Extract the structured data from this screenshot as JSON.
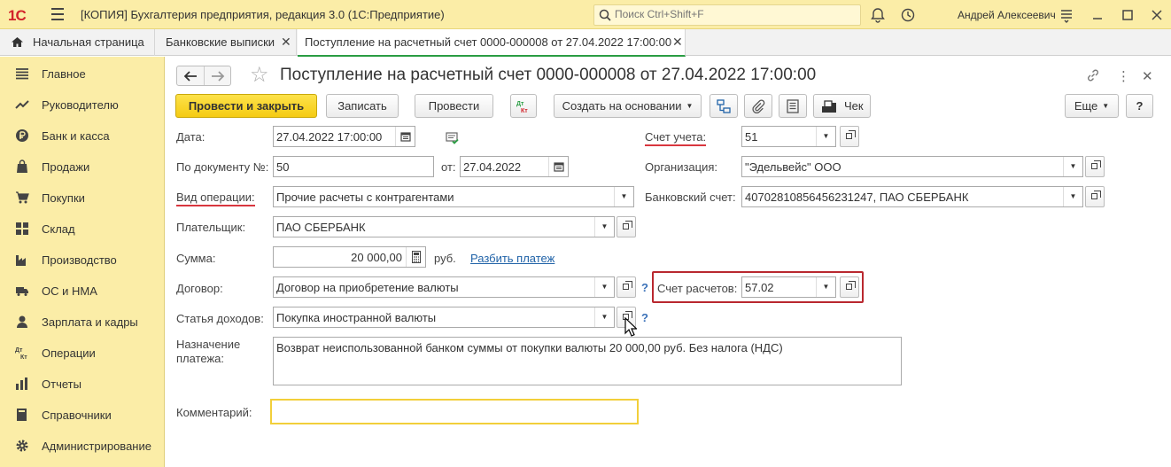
{
  "app": {
    "logo": "1С",
    "title": "[КОПИЯ] Бухгалтерия предприятия, редакция 3.0  (1С:Предприятие)",
    "search_placeholder": "Поиск Ctrl+Shift+F",
    "user_name": "Андрей Алексеевич"
  },
  "tabs": [
    {
      "label": "Начальная страница"
    },
    {
      "label": "Банковские выписки"
    },
    {
      "label": "Поступление на расчетный счет 0000-000008 от 27.04.2022 17:00:00"
    }
  ],
  "sidebar": {
    "items": [
      {
        "label": "Главное",
        "icon": "list-icon"
      },
      {
        "label": "Руководителю",
        "icon": "trend-icon"
      },
      {
        "label": "Банк и касса",
        "icon": "ruble-coin-icon"
      },
      {
        "label": "Продажи",
        "icon": "bag-icon"
      },
      {
        "label": "Покупки",
        "icon": "cart-icon"
      },
      {
        "label": "Склад",
        "icon": "grid-icon"
      },
      {
        "label": "Производство",
        "icon": "factory-icon"
      },
      {
        "label": "ОС и НМА",
        "icon": "truck-icon"
      },
      {
        "label": "Зарплата и кадры",
        "icon": "person-icon"
      },
      {
        "label": "Операции",
        "icon": "dt-kt-icon"
      },
      {
        "label": "Отчеты",
        "icon": "bar-chart-icon"
      },
      {
        "label": "Справочники",
        "icon": "book-icon"
      },
      {
        "label": "Администрирование",
        "icon": "gear-icon"
      }
    ]
  },
  "document": {
    "title": "Поступление на расчетный счет 0000-000008 от 27.04.2022 17:00:00"
  },
  "toolbar": {
    "post_close": "Провести и закрыть",
    "save": "Записать",
    "post": "Провести",
    "dtkt": "Дт Кт",
    "create_based": "Создать на основании",
    "check": "Чек",
    "more": "Еще",
    "help": "?"
  },
  "form": {
    "date_label": "Дата:",
    "date_value": "27.04.2022 17:00:00",
    "doc_no_label": "По документу №:",
    "doc_no_value": "50",
    "from_label": "от:",
    "from_value": "27.04.2022",
    "op_type_label": "Вид операции:",
    "op_type_value": "Прочие расчеты с контрагентами",
    "payer_label": "Плательщик:",
    "payer_value": "ПАО СБЕРБАНК",
    "sum_label": "Сумма:",
    "sum_value": "20 000,00",
    "currency": "руб.",
    "split_link": "Разбить платеж",
    "contract_label": "Договор:",
    "contract_value": "Договор на приобретение валюты",
    "income_item_label": "Статья доходов:",
    "income_item_value": "Покупка иностранной валюты",
    "purpose_label": "Назначение платежа:",
    "purpose_value": "Возврат неиспользованной банком суммы от покупки валюты 20 000,00 руб. Без налога (НДС)",
    "comment_label": "Комментарий:",
    "comment_value": "",
    "account_label": "Счет учета:",
    "account_value": "51",
    "org_label": "Организация:",
    "org_value": "\"Эдельвейс\" ООО",
    "bank_account_label": "Банковский счет:",
    "bank_account_value": "40702810856456231247, ПАО СБЕРБАНК",
    "settlement_account_label": "Счет расчетов:",
    "settlement_account_value": "57.02",
    "help_mark": "?"
  },
  "colors": {
    "brand_yellow": "#fbeda7",
    "primary_button": "#f5cb13",
    "highlight_red": "#b9282f",
    "active_tab": "#2a9d43",
    "link": "#2163a8"
  }
}
